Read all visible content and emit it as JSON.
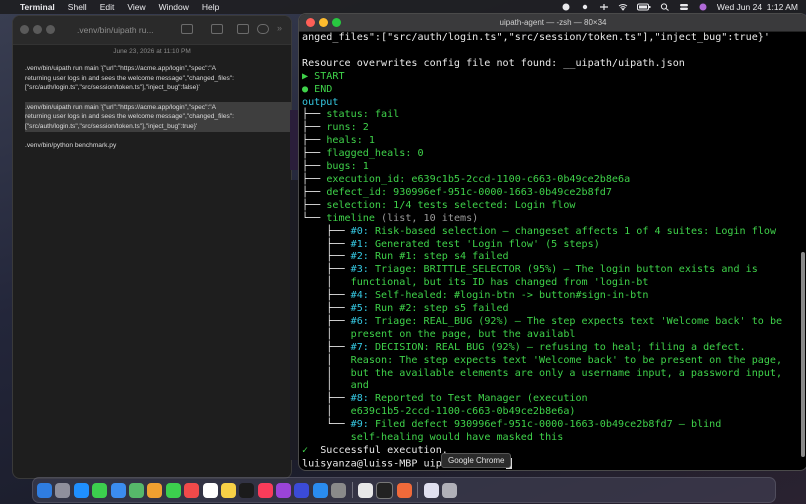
{
  "menubar": {
    "app_name": "Terminal",
    "items": [
      "Shell",
      "Edit",
      "View",
      "Window",
      "Help"
    ],
    "clock": "Wed Jun 24  1:12 AM"
  },
  "notes_window": {
    "title": ".venv/bin/uipath ru...",
    "date": "June 23, 2026 at 11:10 PM",
    "paragraphs": [
      {
        "lines": [
          ".venv/bin/uipath run main '{\"url\":\"https://acme.app/login\",\"spec\":\"A",
          "returning user logs in and sees the welcome message\",\"changed_files\":",
          "[\"src/auth/login.ts\",\"src/session/token.ts\"],\"inject_bug\":false}'"
        ]
      },
      {
        "lines": [
          ".venv/bin/uipath run main '{\"url\":\"https://acme.app/login\",\"spec\":\"A",
          "returning user logs in and sees the welcome message\",\"changed_files\":",
          "[\"src/auth/login.ts\",\"src/session/token.ts\"],\"inject_bug\":true}'"
        ]
      },
      {
        "lines": [
          ".venv/bin/python benchmark.py"
        ]
      }
    ]
  },
  "terminal": {
    "title": "uipath-agent — -zsh — 80×34",
    "lines": [
      {
        "parts": [
          {
            "t": "anged_files\":[\"src/auth/login.ts\",\"src/session/token.ts\"],\"inject_bug\":true}'",
            "c": "c-wh"
          }
        ]
      },
      {
        "parts": [
          {
            "t": " ",
            "c": "c-wh"
          }
        ]
      },
      {
        "parts": [
          {
            "t": "Resource overwrites config file not found: __uipath/uipath.json",
            "c": "c-wh"
          }
        ]
      },
      {
        "parts": [
          {
            "t": "▶ START",
            "c": "c-gr"
          }
        ]
      },
      {
        "parts": [
          {
            "t": "● END",
            "c": "c-gr"
          }
        ]
      },
      {
        "parts": [
          {
            "t": "output",
            "c": "c-cy"
          }
        ]
      },
      {
        "parts": [
          {
            "t": "├── ",
            "c": "c-wh"
          },
          {
            "t": "status: fail",
            "c": "c-gr"
          }
        ]
      },
      {
        "parts": [
          {
            "t": "├── ",
            "c": "c-wh"
          },
          {
            "t": "runs: 2",
            "c": "c-gr"
          }
        ]
      },
      {
        "parts": [
          {
            "t": "├── ",
            "c": "c-wh"
          },
          {
            "t": "heals: 1",
            "c": "c-gr"
          }
        ]
      },
      {
        "parts": [
          {
            "t": "├── ",
            "c": "c-wh"
          },
          {
            "t": "flagged_heals: 0",
            "c": "c-gr"
          }
        ]
      },
      {
        "parts": [
          {
            "t": "├── ",
            "c": "c-wh"
          },
          {
            "t": "bugs: 1",
            "c": "c-gr"
          }
        ]
      },
      {
        "parts": [
          {
            "t": "├── ",
            "c": "c-wh"
          },
          {
            "t": "execution_id: e639c1b5-2ccd-1100-c663-0b49ce2b8e6a",
            "c": "c-gr"
          }
        ]
      },
      {
        "parts": [
          {
            "t": "├── ",
            "c": "c-wh"
          },
          {
            "t": "defect_id: 930996ef-951c-0000-1663-0b49ce2b8fd7",
            "c": "c-gr"
          }
        ]
      },
      {
        "parts": [
          {
            "t": "├── ",
            "c": "c-wh"
          },
          {
            "t": "selection: 1/4 tests selected: Login flow",
            "c": "c-gr"
          }
        ]
      },
      {
        "parts": [
          {
            "t": "└── ",
            "c": "c-wh"
          },
          {
            "t": "timeline",
            "c": "c-gr"
          },
          {
            "t": " (list, 10 items)",
            "c": "c-dim"
          }
        ]
      },
      {
        "parts": [
          {
            "t": "    ├── ",
            "c": "c-wh"
          },
          {
            "t": "#0: ",
            "c": "c-cy"
          },
          {
            "t": "Risk-based selection — changeset affects 1 of 4 suites: Login flow",
            "c": "c-gr"
          }
        ]
      },
      {
        "parts": [
          {
            "t": "    ├── ",
            "c": "c-wh"
          },
          {
            "t": "#1: ",
            "c": "c-cy"
          },
          {
            "t": "Generated test 'Login flow' (5 steps)",
            "c": "c-gr"
          }
        ]
      },
      {
        "parts": [
          {
            "t": "    ├── ",
            "c": "c-wh"
          },
          {
            "t": "#2: ",
            "c": "c-cy"
          },
          {
            "t": "Run #1: step s4 failed",
            "c": "c-gr"
          }
        ]
      },
      {
        "parts": [
          {
            "t": "    ├── ",
            "c": "c-wh"
          },
          {
            "t": "#3: ",
            "c": "c-cy"
          },
          {
            "t": "Triage: BRITTLE_SELECTOR (95%) — The login button exists and is",
            "c": "c-gr"
          }
        ]
      },
      {
        "parts": [
          {
            "t": "    │   ",
            "c": "c-wh"
          },
          {
            "t": "functional, but its ID has changed from 'login-bt",
            "c": "c-gr"
          }
        ]
      },
      {
        "parts": [
          {
            "t": "    ├── ",
            "c": "c-wh"
          },
          {
            "t": "#4: ",
            "c": "c-cy"
          },
          {
            "t": "Self-healed: #login-btn -> button#sign-in-btn",
            "c": "c-gr"
          }
        ]
      },
      {
        "parts": [
          {
            "t": "    ├── ",
            "c": "c-wh"
          },
          {
            "t": "#5: ",
            "c": "c-cy"
          },
          {
            "t": "Run #2: step s5 failed",
            "c": "c-gr"
          }
        ]
      },
      {
        "parts": [
          {
            "t": "    ├── ",
            "c": "c-wh"
          },
          {
            "t": "#6: ",
            "c": "c-cy"
          },
          {
            "t": "Triage: REAL_BUG (92%) — The step expects text 'Welcome back' to be",
            "c": "c-gr"
          }
        ]
      },
      {
        "parts": [
          {
            "t": "    │   ",
            "c": "c-wh"
          },
          {
            "t": "present on the page, but the availabl",
            "c": "c-gr"
          }
        ]
      },
      {
        "parts": [
          {
            "t": "    ├── ",
            "c": "c-wh"
          },
          {
            "t": "#7: ",
            "c": "c-cy"
          },
          {
            "t": "DECISION: REAL BUG (92%) — refusing to heal; filing a defect.",
            "c": "c-gr"
          }
        ]
      },
      {
        "parts": [
          {
            "t": "    │   ",
            "c": "c-wh"
          },
          {
            "t": "Reason: The step expects text 'Welcome back' to be present on the page,",
            "c": "c-gr"
          }
        ]
      },
      {
        "parts": [
          {
            "t": "    │   ",
            "c": "c-wh"
          },
          {
            "t": "but the available elements are only a username input, a password input,",
            "c": "c-gr"
          }
        ]
      },
      {
        "parts": [
          {
            "t": "    │   ",
            "c": "c-wh"
          },
          {
            "t": "and",
            "c": "c-gr"
          }
        ]
      },
      {
        "parts": [
          {
            "t": "    ├── ",
            "c": "c-wh"
          },
          {
            "t": "#8: ",
            "c": "c-cy"
          },
          {
            "t": "Reported to Test Manager (execution",
            "c": "c-gr"
          }
        ]
      },
      {
        "parts": [
          {
            "t": "    │   ",
            "c": "c-wh"
          },
          {
            "t": "e639c1b5-2ccd-1100-c663-0b49ce2b8e6a)",
            "c": "c-gr"
          }
        ]
      },
      {
        "parts": [
          {
            "t": "    └── ",
            "c": "c-wh"
          },
          {
            "t": "#9: ",
            "c": "c-cy"
          },
          {
            "t": "Filed defect 930996ef-951c-0000-1663-0b49ce2b8fd7 — blind",
            "c": "c-gr"
          }
        ]
      },
      {
        "parts": [
          {
            "t": "        ",
            "c": "c-wh"
          },
          {
            "t": "self-healing would have masked this",
            "c": "c-gr"
          }
        ]
      },
      {
        "parts": [
          {
            "t": "✓ ",
            "c": "c-gr"
          },
          {
            "t": " Successful execution.",
            "c": "c-wh"
          }
        ]
      },
      {
        "parts": [
          {
            "t": "luisyanza@luiss-MBP uip",
            "c": "c-wh"
          }
        ]
      }
    ]
  },
  "tooltip": "Google Chrome",
  "colors": {
    "accent_green": "#3fd24a",
    "accent_cyan": "#35c7e0"
  },
  "dock": {
    "icons": [
      "finder-icon",
      "launchpad-icon",
      "safari-icon",
      "messages-icon",
      "mail-icon",
      "maps-icon",
      "photos-icon",
      "facetime-icon",
      "news-icon",
      "calendar-icon",
      "notes-icon",
      "tv-icon",
      "music-icon",
      "podcasts-icon",
      "shortcuts-icon",
      "app-store-icon",
      "settings-icon",
      "chrome-icon",
      "terminal-icon",
      "app-icon",
      "doc-icon",
      "trash-icon"
    ]
  }
}
